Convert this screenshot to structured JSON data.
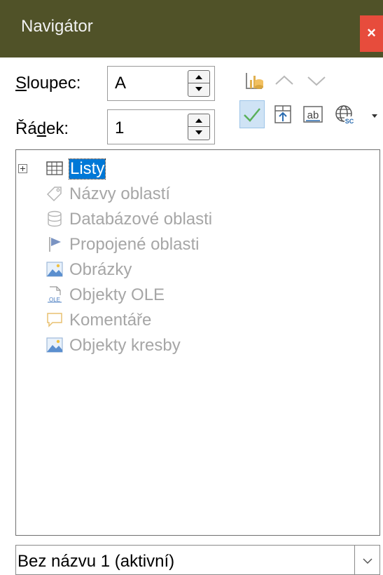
{
  "window": {
    "title": "Navigátor",
    "close_label": "×"
  },
  "fields": {
    "column": {
      "label_accel": "S",
      "label_rest": "loupec:",
      "value": "A"
    },
    "row": {
      "label_pre": "Řá",
      "label_accel": "d",
      "label_rest": "ek:",
      "value": "1"
    }
  },
  "toolbar": {
    "row1": [
      "data-range-icon",
      "chevron-up-icon",
      "chevron-down-icon"
    ],
    "row2": [
      "checkmark-icon",
      "drag-mode-icon",
      "insert-as-text-icon",
      "globe-icon",
      "dropdown-arrow-icon"
    ]
  },
  "tree": {
    "items": [
      {
        "label": "Listy",
        "icon": "sheet-grid-icon",
        "selected": true,
        "expandable": true
      },
      {
        "label": "Názvy oblastí",
        "icon": "tag-icon"
      },
      {
        "label": "Databázové oblasti",
        "icon": "database-icon"
      },
      {
        "label": "Propojené oblasti",
        "icon": "flag-icon"
      },
      {
        "label": "Obrázky",
        "icon": "image-icon"
      },
      {
        "label": "Objekty OLE",
        "icon": "ole-object-icon"
      },
      {
        "label": "Komentáře",
        "icon": "comment-icon"
      },
      {
        "label": "Objekty kresby",
        "icon": "image-icon"
      }
    ]
  },
  "document_select": {
    "value": "Bez názvu 1 (aktivní)"
  },
  "colors": {
    "titlebar": "#505228",
    "close": "#e74c3c",
    "selection": "#0078d7"
  }
}
